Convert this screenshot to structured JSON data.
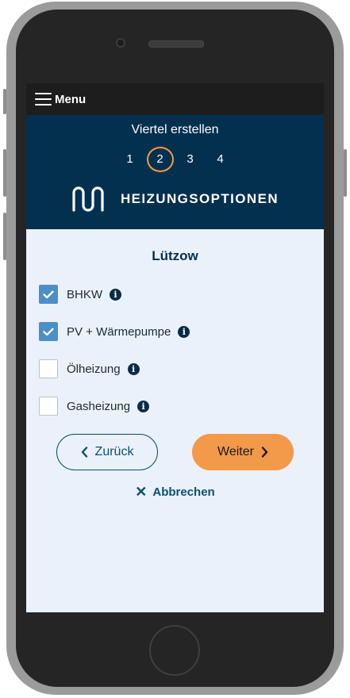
{
  "topbar": {
    "menu_label": "Menu"
  },
  "header": {
    "title": "Viertel erstellen",
    "steps": [
      "1",
      "2",
      "3",
      "4"
    ],
    "active_step": "2",
    "brand_name": "HEIZUNGSOPTIONEN"
  },
  "main": {
    "district": "Lützow",
    "options": [
      {
        "label": "BHKW",
        "checked": true
      },
      {
        "label": "PV + Wärmepumpe",
        "checked": true
      },
      {
        "label": "Ölheizung",
        "checked": false
      },
      {
        "label": "Gasheizung",
        "checked": false
      }
    ],
    "info_glyph": "i",
    "back_label": "Zurück",
    "next_label": "Weiter",
    "cancel_label": "Abbrechen",
    "cancel_glyph": "✕"
  },
  "colors": {
    "header_bg": "#04304f",
    "topbar_bg": "#1d1d1d",
    "screen_bg": "#eaf1fa",
    "accent_orange": "#f2994a",
    "checkbox_checked": "#4c8ec6",
    "primary_text": "#0d4f6f"
  },
  "icons": [
    "hamburger-menu-icon",
    "brand-wave-logo",
    "info-icon",
    "check-icon",
    "chevron-left-icon",
    "chevron-right-icon",
    "close-icon"
  ]
}
